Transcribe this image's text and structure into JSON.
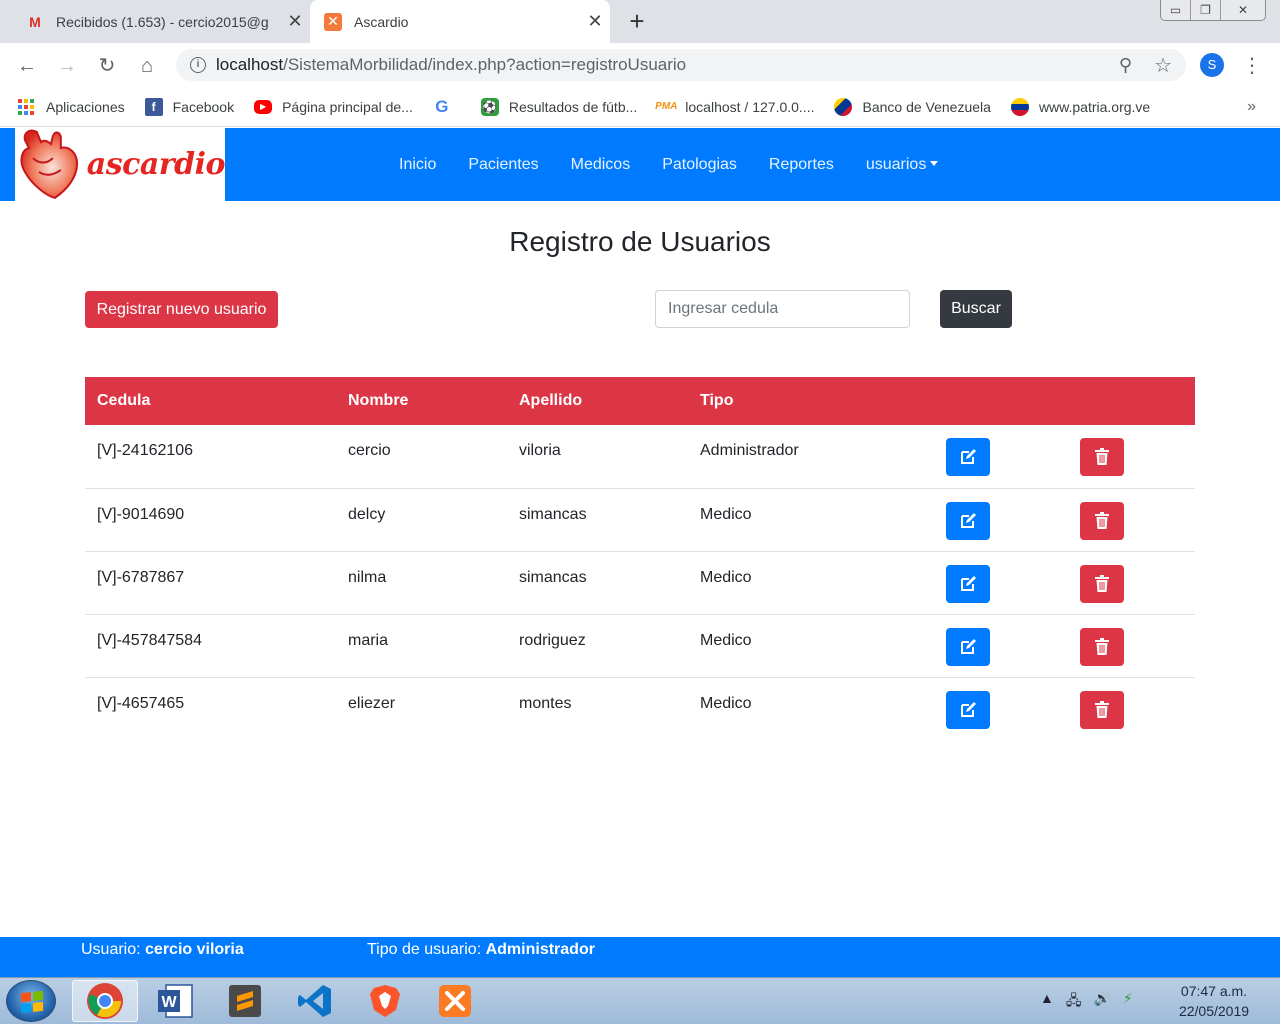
{
  "browser": {
    "tabs": [
      {
        "title": "Recibidos (1.653) - cercio2015@g",
        "icon": "gmail-icon",
        "active": false
      },
      {
        "title": "Ascardio",
        "icon": "xampp-icon",
        "active": true
      }
    ],
    "url_host": "localhost",
    "url_path": "/SistemaMorbilidad/index.php?action=registroUsuario",
    "profile_initial": "S",
    "bookmarks": [
      {
        "label": "Aplicaciones",
        "icon": "apps-icon"
      },
      {
        "label": "Facebook",
        "icon": "facebook-icon"
      },
      {
        "label": "Página principal de...",
        "icon": "youtube-icon"
      },
      {
        "label": "",
        "icon": "google-icon"
      },
      {
        "label": "Resultados de fútb...",
        "icon": "soccer-icon"
      },
      {
        "label": "localhost / 127.0.0....",
        "icon": "phpmyadmin-icon"
      },
      {
        "label": "Banco de Venezuela",
        "icon": "bank-icon"
      },
      {
        "label": "www.patria.org.ve",
        "icon": "patria-icon"
      }
    ],
    "bookmarks_more": "»"
  },
  "app": {
    "brand": "ascardio",
    "nav": [
      "Inicio",
      "Pacientes",
      "Medicos",
      "Patologias",
      "Reportes",
      "usuarios"
    ],
    "colors": {
      "primary": "#007bff",
      "danger": "#dc3545",
      "dark": "#343a40"
    }
  },
  "page": {
    "title": "Registro de Usuarios",
    "new_user_button": "Registrar nuevo usuario",
    "search_placeholder": "Ingresar cedula",
    "search_button": "Buscar"
  },
  "table": {
    "headers": [
      "Cedula",
      "Nombre",
      "Apellido",
      "Tipo"
    ],
    "rows": [
      {
        "cedula": "[V]-24162106",
        "nombre": "cercio",
        "apellido": "viloria",
        "tipo": "Administrador"
      },
      {
        "cedula": "[V]-9014690",
        "nombre": "delcy",
        "apellido": "simancas",
        "tipo": "Medico"
      },
      {
        "cedula": "[V]-6787867",
        "nombre": "nilma",
        "apellido": "simancas",
        "tipo": "Medico"
      },
      {
        "cedula": "[V]-457847584",
        "nombre": "maria",
        "apellido": "rodriguez",
        "tipo": "Medico"
      },
      {
        "cedula": "[V]-4657465",
        "nombre": "eliezer",
        "apellido": "montes",
        "tipo": "Medico"
      }
    ]
  },
  "footer": {
    "user_label": "Usuario:",
    "user_value": "cercio viloria",
    "type_label": "Tipo de usuario:",
    "type_value": "Administrador"
  },
  "taskbar": {
    "apps": [
      "chrome-icon",
      "word-icon",
      "sublime-text-icon",
      "vscode-icon",
      "brave-icon",
      "xampp-icon"
    ],
    "time": "07:47 a.m.",
    "date": "22/05/2019"
  }
}
